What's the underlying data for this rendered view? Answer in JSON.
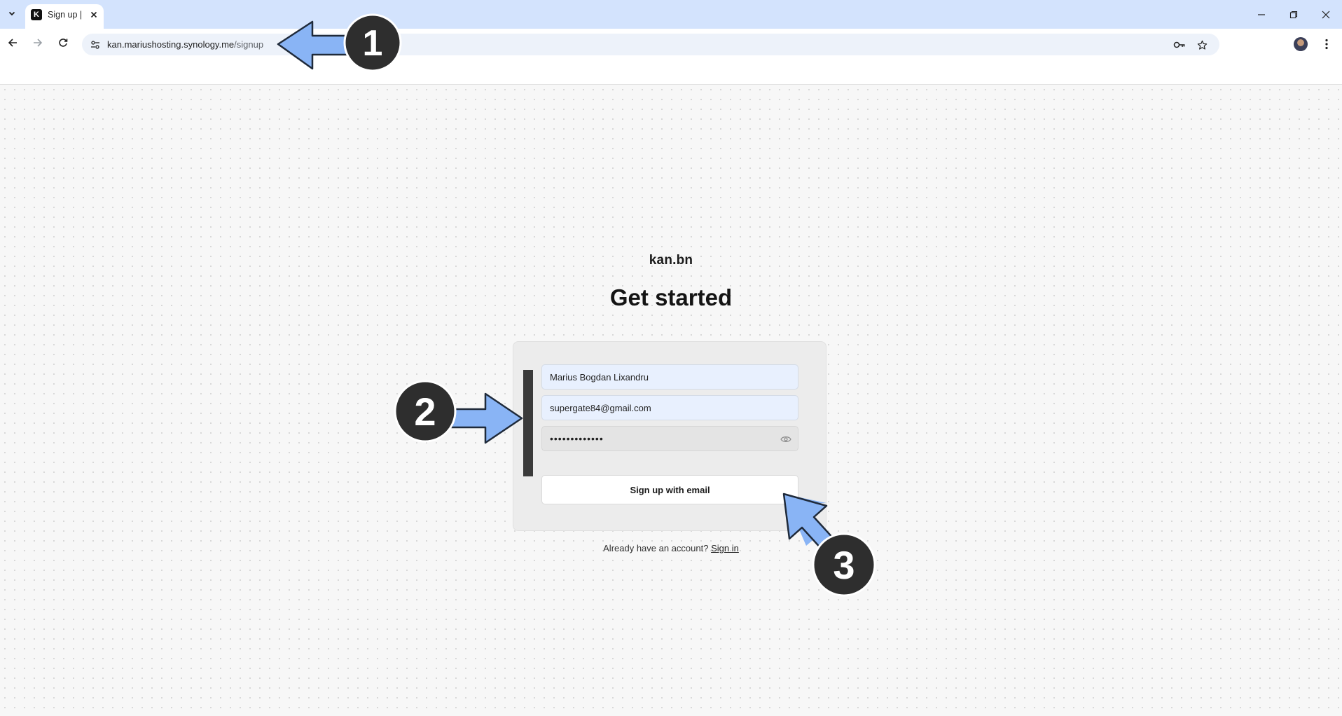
{
  "browser": {
    "tab_title": "Sign up |",
    "favicon_letter": "K",
    "url_host": "kan.mariushosting.synology.me",
    "url_path": "/signup"
  },
  "page": {
    "brand": "kan.bn",
    "heading": "Get started",
    "form": {
      "name_value": "Marius Bogdan Lixandru",
      "email_value": "supergate84@gmail.com",
      "password_value": "•••••••••••••",
      "submit_label": "Sign up with email"
    },
    "signin_prompt": "Already have an account?",
    "signin_link": "Sign in"
  },
  "annotations": {
    "marker_1": "1",
    "marker_2": "2",
    "marker_3": "3",
    "arrow_color": "#89b4f5",
    "marker_color": "#2e2e2e"
  }
}
